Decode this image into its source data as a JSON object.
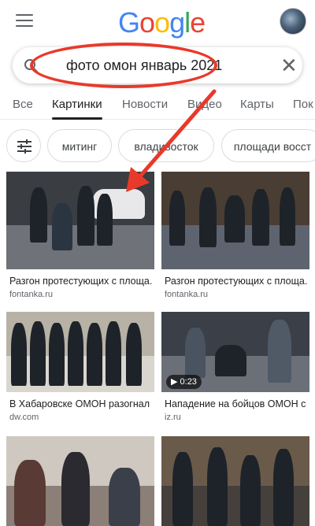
{
  "header": {
    "logo_letters": [
      "G",
      "o",
      "o",
      "g",
      "l",
      "e"
    ]
  },
  "search": {
    "query": "фото омон январь 2021"
  },
  "tabs": [
    {
      "label": "Все"
    },
    {
      "label": "Картинки"
    },
    {
      "label": "Новости"
    },
    {
      "label": "Видео"
    },
    {
      "label": "Карты"
    },
    {
      "label": "Пок"
    }
  ],
  "chips": [
    {
      "label": "митинг"
    },
    {
      "label": "владивосток"
    },
    {
      "label": "площади восст"
    }
  ],
  "results": [
    {
      "caption": "Разгон протестующих с площа...",
      "source": "fontanka.ru"
    },
    {
      "caption": "Разгон протестующих с площа...",
      "source": "fontanka.ru"
    },
    {
      "caption": "В Хабаровске ОМОН разогнал ...",
      "source": "dw.com"
    },
    {
      "caption": "Нападение на бойцов ОМОН с ...",
      "source": "iz.ru",
      "video_duration": "0:23"
    },
    {
      "caption": "",
      "source": ""
    },
    {
      "caption": "",
      "source": ""
    }
  ],
  "colors": {
    "annotation_red": "#e8392b",
    "google_blue": "#4285F4",
    "google_red": "#EA4335",
    "google_yellow": "#FBBC05",
    "google_green": "#34A853"
  }
}
